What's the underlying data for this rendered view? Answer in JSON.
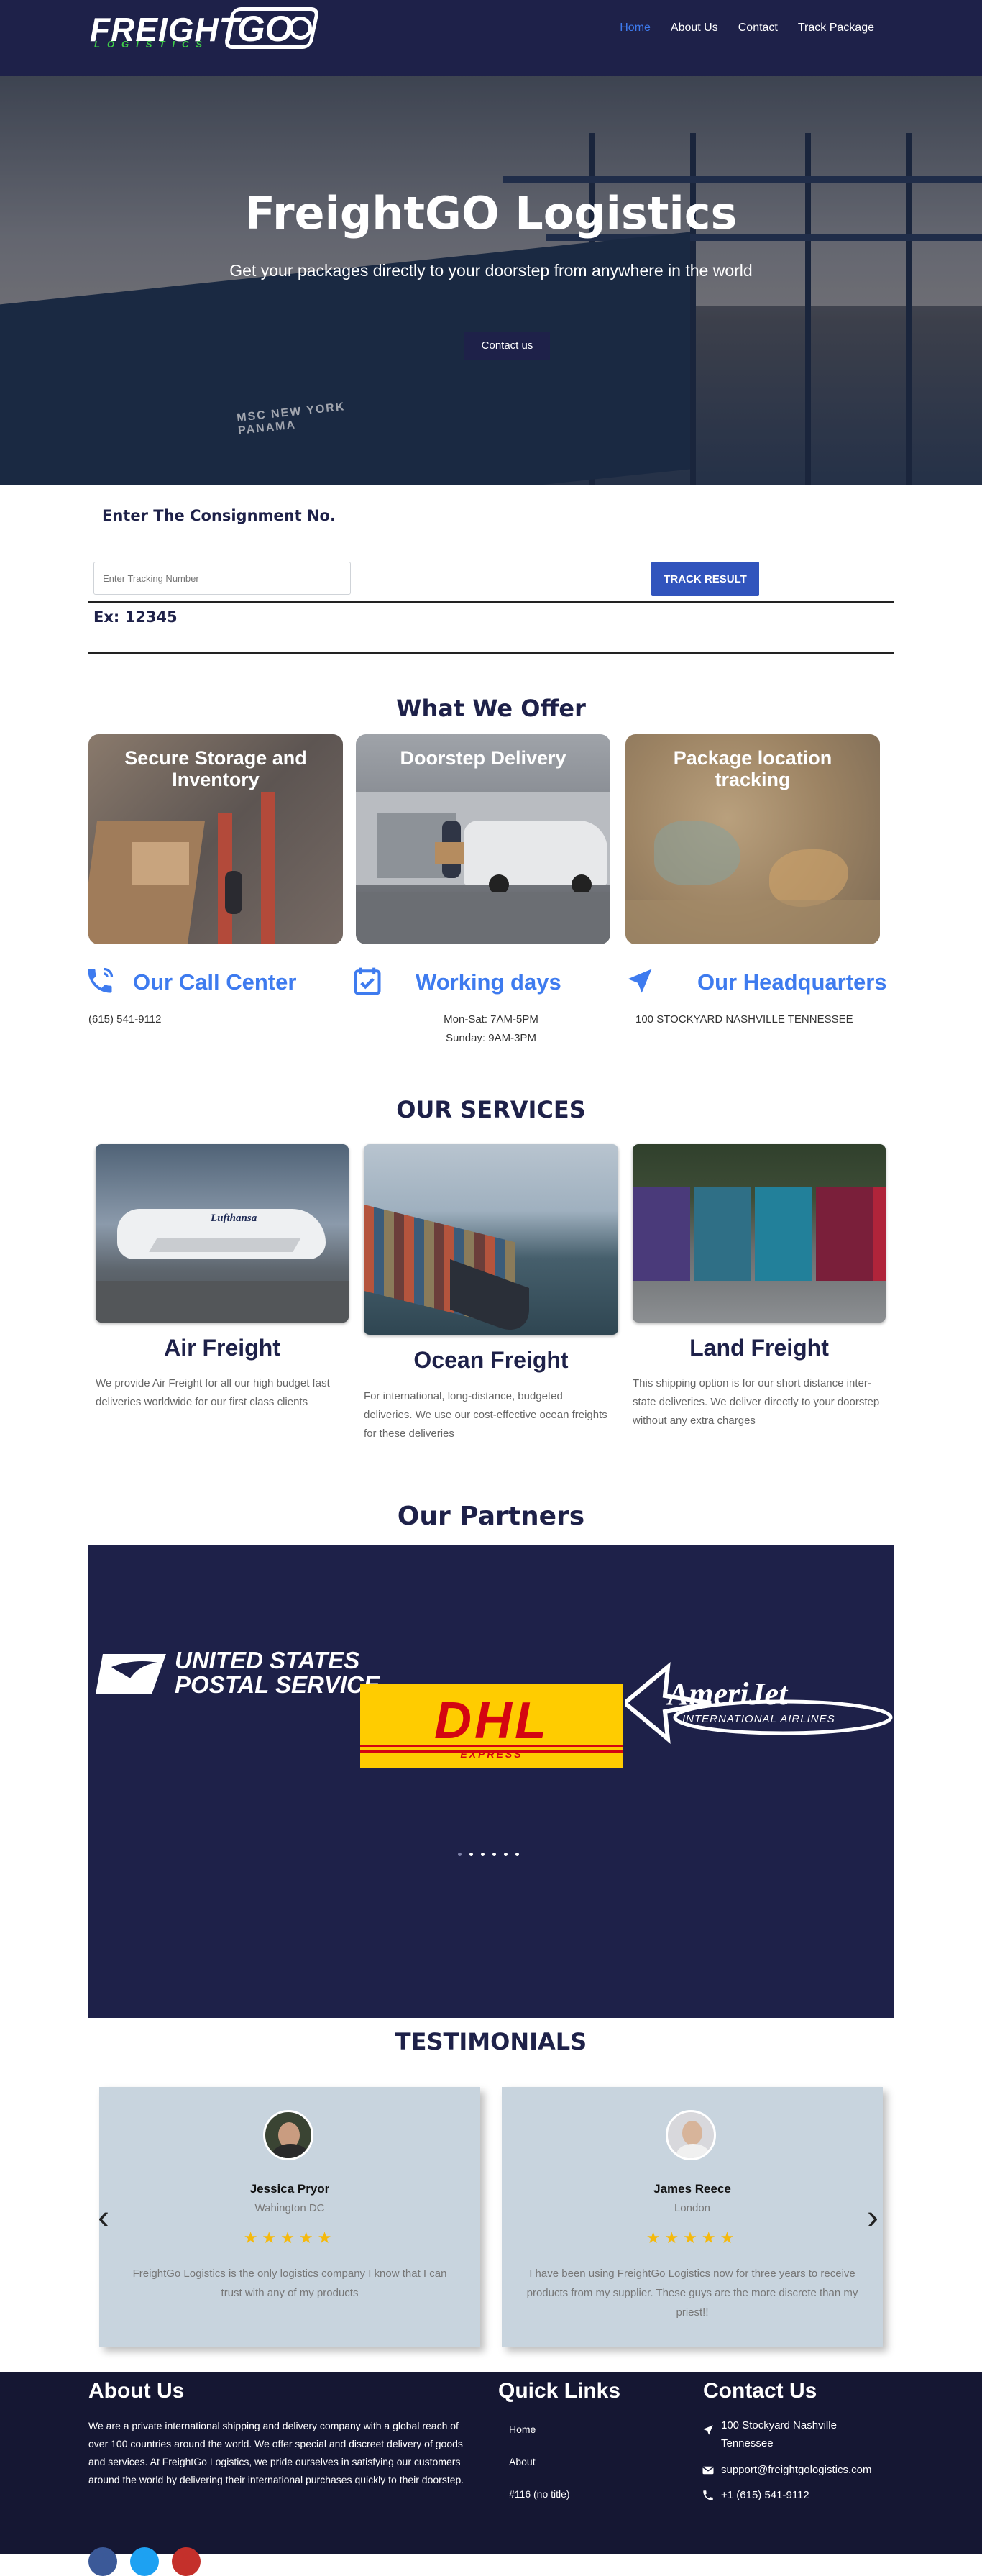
{
  "nav": {
    "logo_word": "FREIGHT",
    "logo_sub": "LOGISTICS",
    "logo_go": "GO",
    "items": [
      {
        "label": "Home",
        "active": true
      },
      {
        "label": "About Us",
        "active": false
      },
      {
        "label": "Contact",
        "active": false
      },
      {
        "label": "Track Package",
        "active": false
      }
    ]
  },
  "hero": {
    "title": "FreightGO Logistics",
    "subtitle": "Get your packages directly to your doorstep from anywhere in the world",
    "cta": "Contact us",
    "ship_name": "MSC NEW YORK",
    "ship_port": "PANAMA"
  },
  "tracking": {
    "title": "Enter The Consignment No.",
    "placeholder": "Enter Tracking Number",
    "button": "TRACK RESULT",
    "example": "Ex: 12345"
  },
  "offer": {
    "title": "What We Offer",
    "cards": [
      {
        "title": "Secure Storage and Inventory"
      },
      {
        "title": "Doorstep Delivery"
      },
      {
        "title": "Package location tracking"
      }
    ]
  },
  "info": {
    "call": {
      "title": "Our Call Center",
      "text": "(615) 541-9112"
    },
    "hours": {
      "title": "Working days",
      "line1": "Mon-Sat: 7AM-5PM",
      "line2": "Sunday: 9AM-3PM"
    },
    "hq": {
      "title": "Our Headquarters",
      "text": "100 STOCKYARD NASHVILLE TENNESSEE"
    }
  },
  "services": {
    "title": "OUR SERVICES",
    "items": [
      {
        "title": "Air Freight",
        "text": "We provide Air Freight for all our high budget fast deliveries worldwide for our first class clients"
      },
      {
        "title": "Ocean Freight",
        "text": "For international, long-distance, budgeted deliveries. We use our cost-effective ocean freights for these deliveries"
      },
      {
        "title": "Land Freight",
        "text": "This shipping option is for our short distance inter-state deliveries. We deliver directly to your doorstep without any extra charges"
      }
    ],
    "plane_text": "Lufthansa"
  },
  "partners": {
    "title": "Our Partners",
    "usps_line1": "UNITED STATES",
    "usps_line2": "POSTAL SERVICE",
    "dhl": "DHL",
    "dhl_sub": "EXPRESS",
    "amerijet": "AmeriJet",
    "amerijet_sub": "INTERNATIONAL AIRLINES"
  },
  "testimonials": {
    "title": "TESTIMONIALS",
    "items": [
      {
        "name": "Jessica Pryor",
        "location": "Wahington DC",
        "rating": 5,
        "stars": "★★★★★",
        "quote": "FreightGo Logistics is the only logistics company I know that I can trust with any of my products"
      },
      {
        "name": "James Reece",
        "location": "London",
        "rating": 5,
        "stars": "★★★★★",
        "quote": "I have been using FreightGo Logistics now for three years to receive products from my supplier. These guys are the more discrete than my priest!!"
      }
    ],
    "prev": "‹",
    "next": "›"
  },
  "footer": {
    "about_title": "About Us",
    "about_text": "We are a private international shipping and delivery company with a global reach of over 100 countries around the world. We offer special and discreet delivery of goods and services. At FreightGo Logistics, we pride ourselves in satisfying our customers around the world by delivering their international purchases quickly to their doorstep.",
    "links_title": "Quick Links",
    "links": [
      "Home",
      "About",
      "#116 (no title)"
    ],
    "contact_title": "Contact Us",
    "address_line1": "100 Stockyard Nashville",
    "address_line2": "Tennessee",
    "email": "support@freightgologistics.com",
    "phone": "+1 (615) 541-9112",
    "social_colors": [
      "#3b5998",
      "#1da1f2",
      "#c4302b"
    ]
  },
  "colors": {
    "navy": "#1e2149",
    "accent": "#3e7bef",
    "button_blue": "#3154bd",
    "star": "#f5b90c",
    "footer": "#151733"
  }
}
